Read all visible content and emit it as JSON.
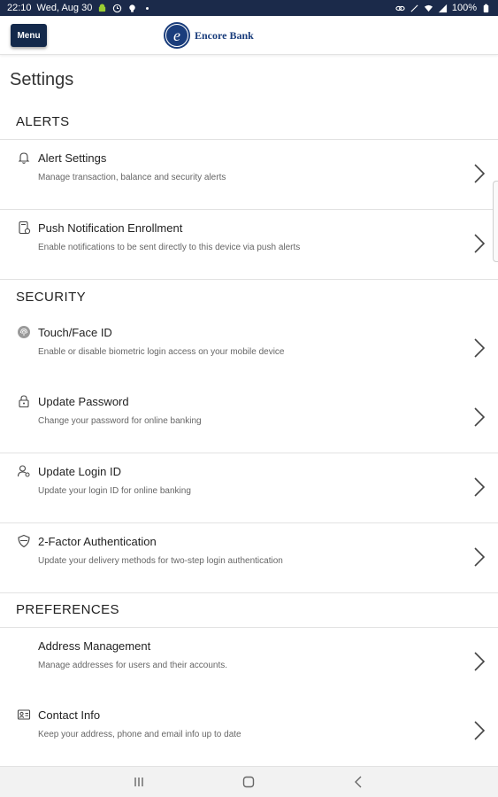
{
  "status_bar": {
    "time": "22:10",
    "date": "Wed, Aug 30",
    "battery": "100%",
    "left_icons": [
      "android-icon",
      "clock-icon",
      "bulb-icon",
      "dot-icon"
    ],
    "right_icons": [
      "link-icon",
      "mute-icon",
      "wifi-icon",
      "signal-icon",
      "battery-icon"
    ]
  },
  "header": {
    "menu_label": "Menu",
    "brand_name": "Encore Bank",
    "brand_color": "#13294b"
  },
  "page": {
    "title": "Settings"
  },
  "sections": {
    "alerts": {
      "title": "ALERTS",
      "items": [
        {
          "icon": "bell-icon",
          "title": "Alert Settings",
          "description": "Manage transaction, balance and security alerts"
        },
        {
          "icon": "phone-notification-icon",
          "title": "Push Notification Enrollment",
          "description": "Enable notifications to be sent directly to this device via push alerts"
        }
      ]
    },
    "security": {
      "title": "SECURITY",
      "items": [
        {
          "icon": "fingerprint-icon",
          "title": "Touch/Face ID",
          "description": "Enable or disable biometric login access on your mobile device"
        },
        {
          "icon": "lock-icon",
          "title": "Update Password",
          "description": "Change your password for online banking"
        },
        {
          "icon": "user-key-icon",
          "title": "Update Login ID",
          "description": "Update your login ID for online banking"
        },
        {
          "icon": "shield-icon",
          "title": "2-Factor Authentication",
          "description": "Update your delivery methods for two-step login authentication"
        }
      ]
    },
    "preferences": {
      "title": "PREFERENCES",
      "items": [
        {
          "icon": "",
          "title": "Address Management",
          "description": "Manage addresses for users and their accounts."
        },
        {
          "icon": "contact-card-icon",
          "title": "Contact Info",
          "description": "Keep your address, phone and email info up to date"
        }
      ]
    }
  },
  "nav_bar": {
    "buttons": [
      "recents-icon",
      "home-icon",
      "back-icon"
    ]
  }
}
